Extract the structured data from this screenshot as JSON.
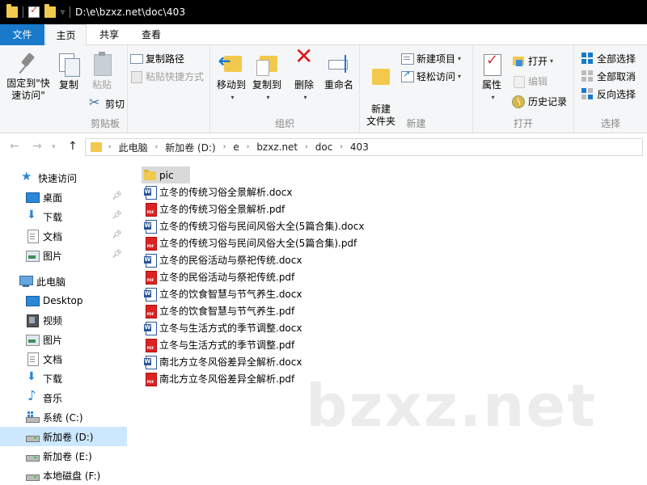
{
  "window": {
    "title": "D:\\e\\bzxz.net\\doc\\403"
  },
  "tabs": {
    "file": "文件",
    "home": "主页",
    "share": "共享",
    "view": "查看"
  },
  "ribbon": {
    "clipboard": {
      "label": "剪贴板",
      "pin_quick": "固定到\"快速访问\"",
      "copy": "复制",
      "paste": "粘贴",
      "copy_path": "复制路径",
      "paste_shortcut": "粘贴快捷方式",
      "cut": "剪切"
    },
    "organize": {
      "label": "组织",
      "move_to": "移动到",
      "copy_to": "复制到",
      "delete": "删除",
      "rename": "重命名"
    },
    "new": {
      "label": "新建",
      "new_folder": "新建\n文件夹",
      "new_item": "新建项目",
      "easy_access": "轻松访问"
    },
    "open": {
      "label": "打开",
      "properties": "属性",
      "open": "打开",
      "edit": "编辑",
      "history": "历史记录"
    },
    "select": {
      "label": "选择",
      "select_all": "全部选择",
      "select_none": "全部取消",
      "invert": "反向选择"
    }
  },
  "breadcrumb": [
    "此电脑",
    "新加卷 (D:)",
    "e",
    "bzxz.net",
    "doc",
    "403"
  ],
  "sidebar": {
    "quick_access": "快速访问",
    "quick_items": [
      "桌面",
      "下载",
      "文档",
      "图片"
    ],
    "this_pc": "此电脑",
    "pc_items": [
      "Desktop",
      "视频",
      "图片",
      "文档",
      "下载",
      "音乐",
      "系统 (C:)",
      "新加卷 (D:)",
      "新加卷 (E:)",
      "本地磁盘 (F:)"
    ]
  },
  "files": [
    {
      "name": "pic",
      "type": "folder"
    },
    {
      "name": "立冬的传统习俗全景解析.docx",
      "type": "docx"
    },
    {
      "name": "立冬的传统习俗全景解析.pdf",
      "type": "pdf"
    },
    {
      "name": "立冬的传统习俗与民间风俗大全(5篇合集).docx",
      "type": "docx"
    },
    {
      "name": "立冬的传统习俗与民间风俗大全(5篇合集).pdf",
      "type": "pdf"
    },
    {
      "name": "立冬的民俗活动与祭祀传统.docx",
      "type": "docx"
    },
    {
      "name": "立冬的民俗活动与祭祀传统.pdf",
      "type": "pdf"
    },
    {
      "name": "立冬的饮食智慧与节气养生.docx",
      "type": "docx"
    },
    {
      "name": "立冬的饮食智慧与节气养生.pdf",
      "type": "pdf"
    },
    {
      "name": "立冬与生活方式的季节调整.docx",
      "type": "docx"
    },
    {
      "name": "立冬与生活方式的季节调整.pdf",
      "type": "pdf"
    },
    {
      "name": "南北方立冬风俗差异全解析.docx",
      "type": "docx"
    },
    {
      "name": "南北方立冬风俗差异全解析.pdf",
      "type": "pdf"
    }
  ],
  "watermark": "bzxz.net"
}
